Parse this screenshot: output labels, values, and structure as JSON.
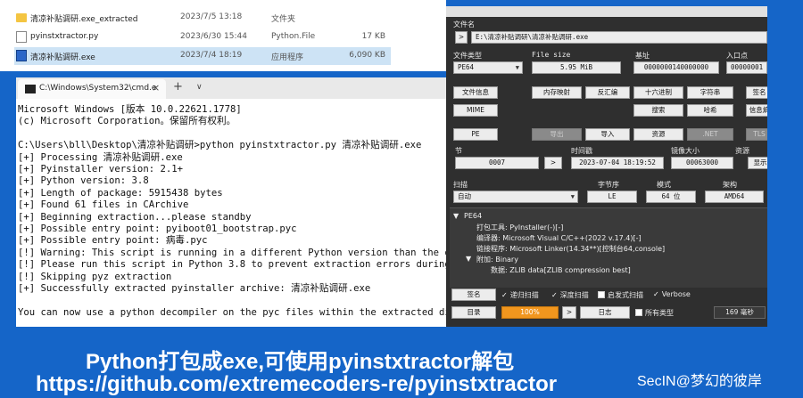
{
  "explorer": {
    "files": [
      {
        "name": "清凉补贴调研.exe_extracted",
        "date": "2023/7/5 13:18",
        "type": "文件夹",
        "size": "",
        "icon": "folder-icon",
        "selected": false
      },
      {
        "name": "pyinstxtractor.py",
        "date": "2023/6/30 15:44",
        "type": "Python.File",
        "size": "17 KB",
        "icon": "python-file-icon",
        "selected": false
      },
      {
        "name": "清凉补贴调研.exe",
        "date": "2023/7/4 18:19",
        "type": "应用程序",
        "size": "6,090 KB",
        "icon": "exe-file-icon",
        "selected": true
      }
    ]
  },
  "terminal": {
    "tab_title": "C:\\Windows\\System32\\cmd.e",
    "close_glyph": "×",
    "add_glyph": "+",
    "dropdown_glyph": "∨",
    "lines": [
      "Microsoft Windows [版本 10.0.22621.1778]",
      "(c) Microsoft Corporation。保留所有权利。",
      "",
      "C:\\Users\\bll\\Desktop\\清凉补贴调研>python pyinstxtractor.py 清凉补贴调研.exe",
      "[+] Processing 清凉补贴调研.exe",
      "[+] Pyinstaller version: 2.1+",
      "[+] Python version: 3.8",
      "[+] Length of package: 5915438 bytes",
      "[+] Found 61 files in CArchive",
      "[+] Beginning extraction...please standby",
      "[+] Possible entry point: pyiboot01_bootstrap.pyc",
      "[+] Possible entry point: 病毒.pyc",
      "[!] Warning: This script is running in a different Python version than the one",
      "[!] Please run this script in Python 3.8 to prevent extraction errors during",
      "[!] Skipping pyz extraction",
      "[+] Successfully extracted pyinstaller archive: 清凉补贴调研.exe",
      "",
      "You can now use a python decompiler on the pyc files within the extracted dir"
    ]
  },
  "die": {
    "file_name_label": "文件名",
    "path_button": ">",
    "file_path": "E:\\清凉补贴调研\\清凉补贴调研.exe",
    "file_type_label": "文件类型",
    "file_type_value": "PE64",
    "file_size_label": "File size",
    "file_size_value": "5.95 MiB",
    "base_label": "基址",
    "base_value": "0000000140000000",
    "entry_label": "入口点",
    "entry_value": "00000001",
    "buttons_row1": [
      "文件信息",
      "内存映射",
      "反汇编",
      "十六进制",
      "字符串",
      "签名"
    ],
    "buttons_row2": [
      "MIME",
      "搜索",
      "哈希",
      "信息熵"
    ],
    "buttons_row3": [
      "PE",
      "导出",
      "导入",
      "资源",
      ".NET",
      "TLS"
    ],
    "section_label": "节",
    "section_value": "0007",
    "section_button": ">",
    "timestamp_label": "时间戳",
    "timestamp_value": "2023-07-04 18:19:52",
    "image_size_label": "镜像大小",
    "image_size_value": "00063000",
    "resource_label": "资源",
    "resource_button": "显示",
    "scan_label": "扫描",
    "scan_value": "自动",
    "endian_label": "字节序",
    "endian_value": "LE",
    "mode_label": "模式",
    "mode_value": "64 位",
    "arch_label": "架构",
    "arch_value": "AMD64",
    "tree": [
      "PE64",
      "打包工具: PyInstaller(-)[-]",
      "编译器: Microsoft Visual C/C++(2022 v.17.4)[-]",
      "链接程序: Microsoft Linker(14.34**)[控制台64,console]",
      "附加: Binary",
      "数据: ZLIB data[ZLIB compression best]"
    ],
    "tree_expand_glyph": "▼",
    "signature_button": "签名",
    "recursive_scan": "递归扫描",
    "deep_scan": "深度扫描",
    "heuristic_scan": "启发式扫描",
    "verbose": "Verbose",
    "directory_button": "目录",
    "progress_value": "100%",
    "progress_fraction": 1.0,
    "progress_button": ">",
    "log_button": "日志",
    "all_types": "所有类型",
    "elapsed": "169 毫秒",
    "check_glyph": "✓"
  },
  "captions": {
    "line1": "Python打包成exe,可使用pyinstxtractor解包",
    "line2": "https://github.com/extremecoders-re/pyinstxtractor",
    "watermark": "SecIN@梦幻的彼岸"
  }
}
